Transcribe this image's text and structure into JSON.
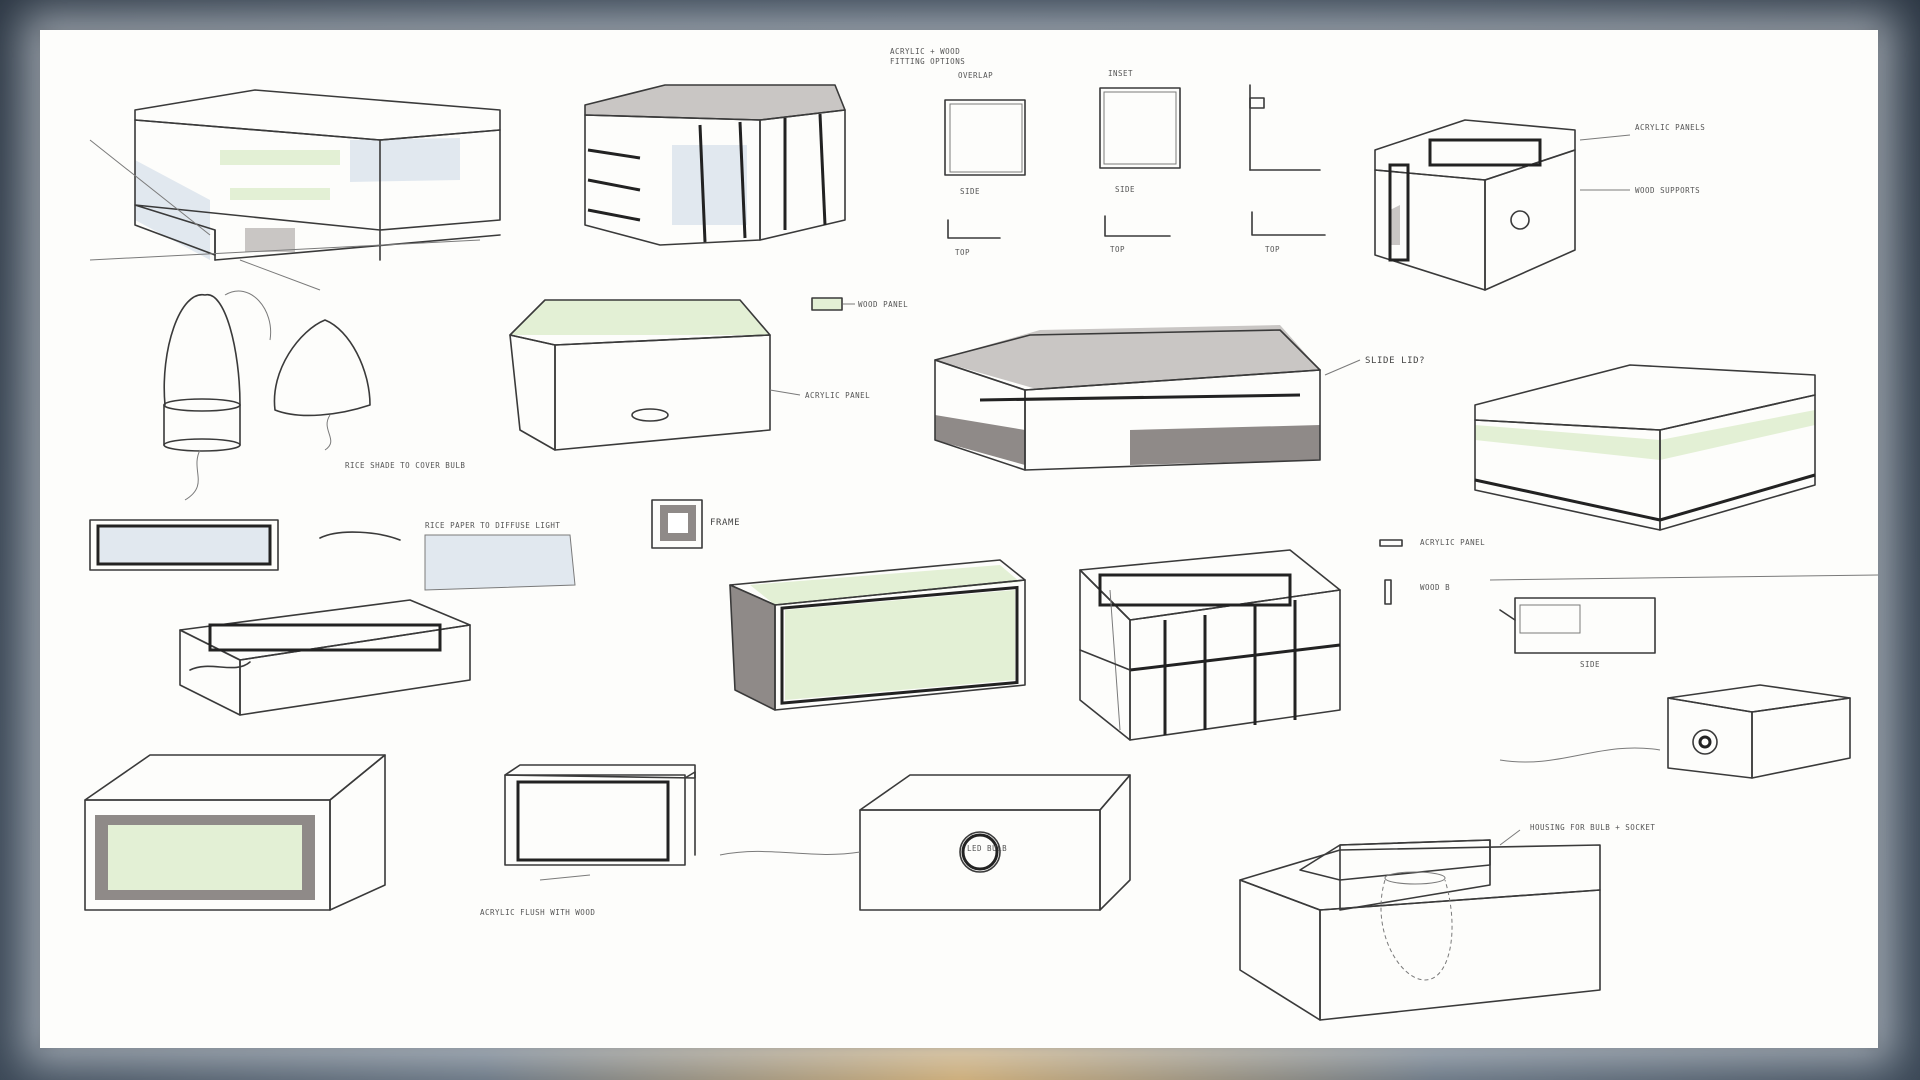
{
  "labels": {
    "fitting_title_1": "ACRYLIC + WOOD",
    "fitting_title_2": "FITTING OPTIONS",
    "overlap": "OVERLAP",
    "inset": "INSET",
    "side1": "SIDE",
    "side2": "SIDE",
    "top1": "TOP",
    "top2": "TOP",
    "top3": "TOP",
    "acrylic_panels_top": "ACRYLIC PANELS",
    "wood_supports": "WOOD SUPPORTS",
    "wood_panel": "WOOD PANEL",
    "acrylic_panel": "ACRYLIC PANEL",
    "slide_lid": "SLIDE LID?",
    "rice_paper": "RICE PAPER TO DIFFUSE LIGHT",
    "frame": "FRAME",
    "acrylic_panel_2": "ACRYLIC PANEL",
    "wood_b": "WOOD B",
    "side3": "SIDE",
    "rice_shade": "RICE SHADE TO COVER BULB",
    "acrylic_flush": "ACRYLIC FLUSH WITH WOOD",
    "led_bulb": "LED BULB",
    "housing": "HOUSING FOR BULB + SOCKET"
  }
}
